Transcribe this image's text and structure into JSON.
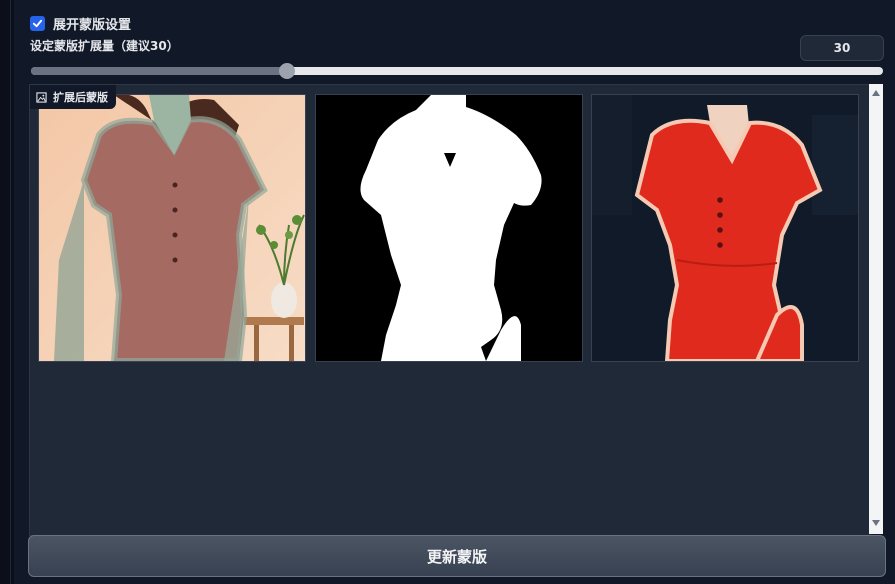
{
  "checkbox": {
    "label": "展开蒙版设置",
    "checked": true
  },
  "slider": {
    "label": "设定蒙版扩展量（建议30）",
    "value": "30",
    "fraction": 0.3
  },
  "gallery": {
    "label": "扩展后蒙版",
    "images": [
      {
        "name": "original-with-mask-overlay"
      },
      {
        "name": "binary-mask"
      },
      {
        "name": "masked-result"
      }
    ]
  },
  "button": {
    "label": "更新蒙版"
  },
  "colors": {
    "accent": "#2563eb",
    "panel": "#111827",
    "gallery_bg": "#1f2937",
    "dress_red": "#e02a1e"
  },
  "icons": {
    "checkbox": "check-icon",
    "gallery_label": "image-icon",
    "scroll_up": "arrow-up-icon",
    "scroll_down": "arrow-down-icon"
  }
}
